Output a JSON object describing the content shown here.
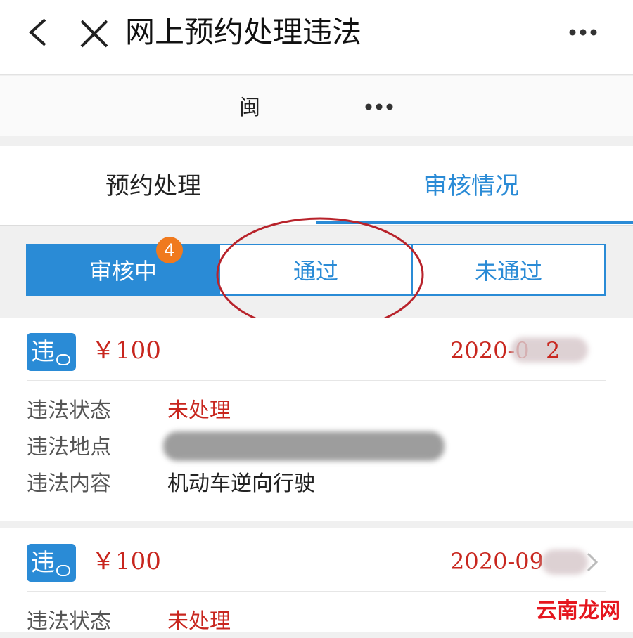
{
  "header": {
    "title": "网上预约处理违法"
  },
  "subbar": {
    "province": "闽"
  },
  "tabs": [
    {
      "label": "预约处理"
    },
    {
      "label": "审核情况"
    }
  ],
  "segments": [
    {
      "label": "审核中",
      "badge": "4"
    },
    {
      "label": "通过"
    },
    {
      "label": "未通过"
    }
  ],
  "records": [
    {
      "icon_text": "违",
      "amount": "￥100",
      "date": "2020-0",
      "date_suffix": "2",
      "status_label": "违法状态",
      "status_value": "未处理",
      "location_label": "违法地点",
      "content_label": "违法内容",
      "content_value": "机动车逆向行驶"
    },
    {
      "icon_text": "违",
      "amount": "￥100",
      "date": "2020-09",
      "status_label": "违法状态",
      "status_value": "未处理"
    }
  ],
  "watermark": "云南龙网",
  "colors": {
    "accent": "#2a8bd6",
    "red": "#c8261e",
    "badge": "#f07a1e",
    "circle": "#b8232b"
  }
}
